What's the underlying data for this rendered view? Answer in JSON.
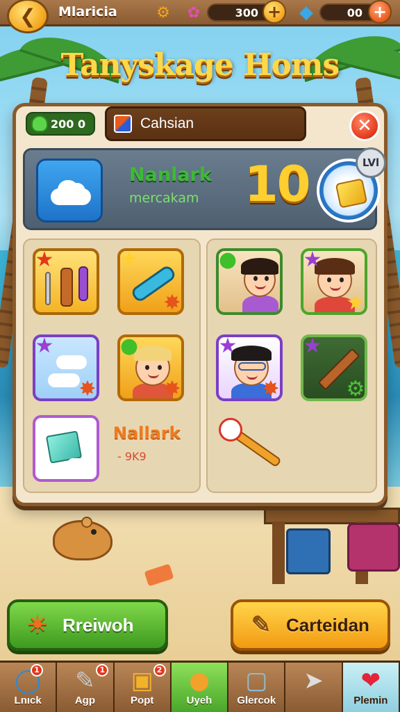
{
  "header": {
    "player_name": "Mlaricia",
    "coins": "300",
    "gems": "00"
  },
  "title": "Tanyskage Homs",
  "panel": {
    "badge_value": "200 0",
    "name": "Cahsian",
    "level_card": {
      "title": "Nanlark",
      "subtitle": "mercakam",
      "level": "10",
      "badge": "LVl"
    },
    "bonus": {
      "name": "Nallark",
      "subtitle": "- 9K9"
    }
  },
  "actions": {
    "left_label": "Rreiwoh",
    "right_label": "Carteidan"
  },
  "nav": {
    "tabs": [
      {
        "label": "Lnıck",
        "icon": "paint-icon",
        "notif": "1"
      },
      {
        "label": "Agp",
        "icon": "pencil-icon",
        "notif": "1"
      },
      {
        "label": "Popt",
        "icon": "gift-box-icon",
        "notif": "2"
      },
      {
        "label": "Uyeh",
        "icon": "balloon-icon"
      },
      {
        "label": "Glercok",
        "icon": "lock-icon"
      },
      {
        "label": "",
        "icon": "map-pin-icon"
      },
      {
        "label": "Plemin",
        "icon": "heart-icon"
      }
    ]
  },
  "colors": {
    "panel_bg": "#f3e6cc",
    "wood": "#8b5a2b",
    "level_gold": "#ffce2f",
    "green_button": "#3e9a1f",
    "orange_button": "#f29a12"
  }
}
